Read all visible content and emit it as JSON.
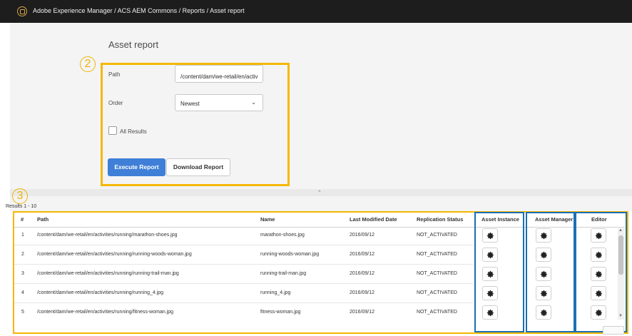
{
  "header": {
    "breadcrumb": "Adobe Experience Manager / ACS AEM Commons / Reports / Asset report"
  },
  "page": {
    "title": "Asset report"
  },
  "callouts": {
    "form_number": "2",
    "results_number": "3"
  },
  "form": {
    "path_label": "Path",
    "path_value": "/content/dam/we-retail/en/activities",
    "order_label": "Order",
    "order_value": "Newest",
    "all_results_label": "All Results",
    "all_results_checked": false,
    "execute_label": "Execute Report",
    "download_label": "Download Report"
  },
  "results": {
    "range_label": "Results 1 - 10",
    "columns": {
      "num": "#",
      "path": "Path",
      "name": "Name",
      "modified": "Last Modified Date",
      "replication": "Replication Status",
      "asset_instance": "Asset Instance",
      "asset_manager": "Asset Manager",
      "editor": "Editor"
    },
    "rows": [
      {
        "num": "1",
        "path": "/content/dam/we-retail/en/activities/running/marathon-shoes.jpg",
        "name": "marathon-shoes.jpg",
        "modified": "2016/09/12",
        "status": "NOT_ACTIVATED"
      },
      {
        "num": "2",
        "path": "/content/dam/we-retail/en/activities/running/running-woods-woman.jpg",
        "name": "running-woods-woman.jpg",
        "modified": "2016/09/12",
        "status": "NOT_ACTIVATED"
      },
      {
        "num": "3",
        "path": "/content/dam/we-retail/en/activities/running/running-trail-man.jpg",
        "name": "running-trail-man.jpg",
        "modified": "2016/09/12",
        "status": "NOT_ACTIVATED"
      },
      {
        "num": "4",
        "path": "/content/dam/we-retail/en/activities/running/running_4.jpg",
        "name": "running_4.jpg",
        "modified": "2016/09/12",
        "status": "NOT_ACTIVATED"
      },
      {
        "num": "5",
        "path": "/content/dam/we-retail/en/activities/running/fitness-woman.jpg",
        "name": "fitness-woman.jpg",
        "modified": "2016/09/12",
        "status": "NOT_ACTIVATED"
      }
    ]
  },
  "colors": {
    "topbar": "#1d1d1d",
    "primary_button": "#3f7fd7",
    "highlight_yellow": "#f5b800",
    "highlight_blue": "#1a6fb5"
  },
  "icons": {
    "app": "aem-logo-icon",
    "order_dropdown": "chevron-down-icon",
    "collapse": "chevron-up-icon",
    "action": "gear-icon"
  }
}
